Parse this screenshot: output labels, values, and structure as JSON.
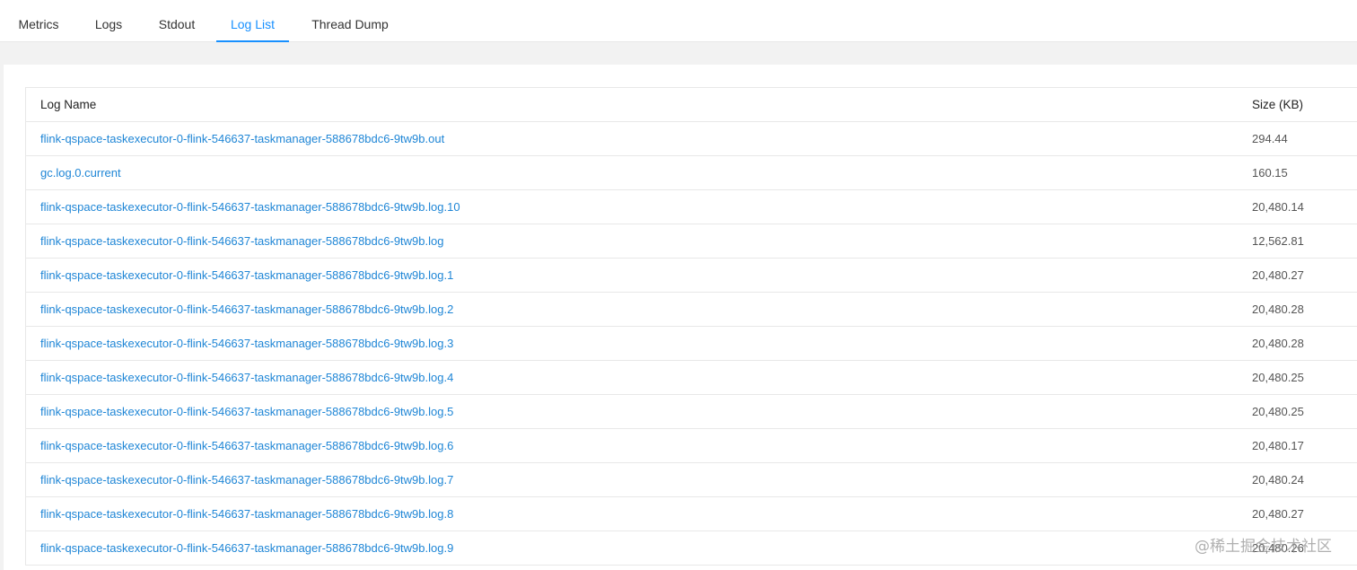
{
  "tabs": [
    {
      "label": "Metrics",
      "active": false
    },
    {
      "label": "Logs",
      "active": false
    },
    {
      "label": "Stdout",
      "active": false
    },
    {
      "label": "Log List",
      "active": true
    },
    {
      "label": "Thread Dump",
      "active": false
    }
  ],
  "colors": {
    "accent": "#1890ff",
    "link": "#1f86d6"
  },
  "table": {
    "headers": {
      "name": "Log Name",
      "size": "Size (KB)"
    },
    "rows": [
      {
        "name": "flink-qspace-taskexecutor-0-flink-546637-taskmanager-588678bdc6-9tw9b.out",
        "size": "294.44"
      },
      {
        "name": "gc.log.0.current",
        "size": "160.15"
      },
      {
        "name": "flink-qspace-taskexecutor-0-flink-546637-taskmanager-588678bdc6-9tw9b.log.10",
        "size": "20,480.14"
      },
      {
        "name": "flink-qspace-taskexecutor-0-flink-546637-taskmanager-588678bdc6-9tw9b.log",
        "size": "12,562.81"
      },
      {
        "name": "flink-qspace-taskexecutor-0-flink-546637-taskmanager-588678bdc6-9tw9b.log.1",
        "size": "20,480.27"
      },
      {
        "name": "flink-qspace-taskexecutor-0-flink-546637-taskmanager-588678bdc6-9tw9b.log.2",
        "size": "20,480.28"
      },
      {
        "name": "flink-qspace-taskexecutor-0-flink-546637-taskmanager-588678bdc6-9tw9b.log.3",
        "size": "20,480.28"
      },
      {
        "name": "flink-qspace-taskexecutor-0-flink-546637-taskmanager-588678bdc6-9tw9b.log.4",
        "size": "20,480.25"
      },
      {
        "name": "flink-qspace-taskexecutor-0-flink-546637-taskmanager-588678bdc6-9tw9b.log.5",
        "size": "20,480.25"
      },
      {
        "name": "flink-qspace-taskexecutor-0-flink-546637-taskmanager-588678bdc6-9tw9b.log.6",
        "size": "20,480.17"
      },
      {
        "name": "flink-qspace-taskexecutor-0-flink-546637-taskmanager-588678bdc6-9tw9b.log.7",
        "size": "20,480.24"
      },
      {
        "name": "flink-qspace-taskexecutor-0-flink-546637-taskmanager-588678bdc6-9tw9b.log.8",
        "size": "20,480.27"
      },
      {
        "name": "flink-qspace-taskexecutor-0-flink-546637-taskmanager-588678bdc6-9tw9b.log.9",
        "size": "20,480.26"
      }
    ]
  },
  "watermark": "@稀土掘金技术社区"
}
